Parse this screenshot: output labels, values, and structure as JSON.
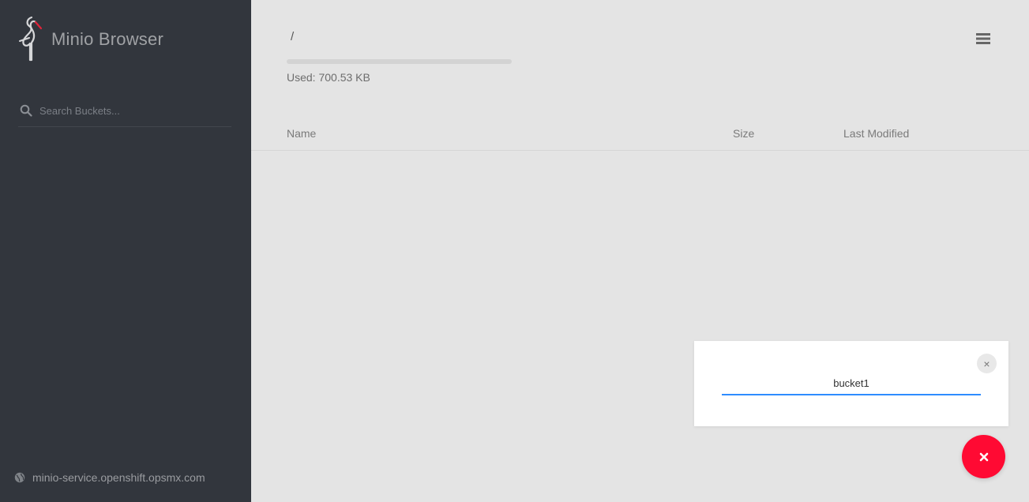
{
  "app": {
    "title": "Minio Browser"
  },
  "sidebar": {
    "search": {
      "placeholder": "Search Buckets...",
      "value": ""
    },
    "host": "minio-service.openshift.opsmx.com",
    "icons": {
      "logo": "minio-crane-logo",
      "search": "search-icon",
      "host": "globe-icon"
    }
  },
  "main": {
    "path": "/",
    "usage": {
      "label": "Used: 700.53 KB",
      "fraction": 0
    },
    "columns": [
      {
        "label": "Name"
      },
      {
        "label": "Size"
      },
      {
        "label": "Last Modified"
      }
    ],
    "menu_icon": "hamburger-menu-icon"
  },
  "dialog": {
    "input_value": "bucket1",
    "close_symbol": "×"
  },
  "fab": {
    "icon": "close-icon"
  },
  "colors": {
    "sidebar_bg": "#32363d",
    "main_bg": "#e4e4e4",
    "accent_blue": "#2e8cff",
    "fab_red": "#ff0a33"
  }
}
